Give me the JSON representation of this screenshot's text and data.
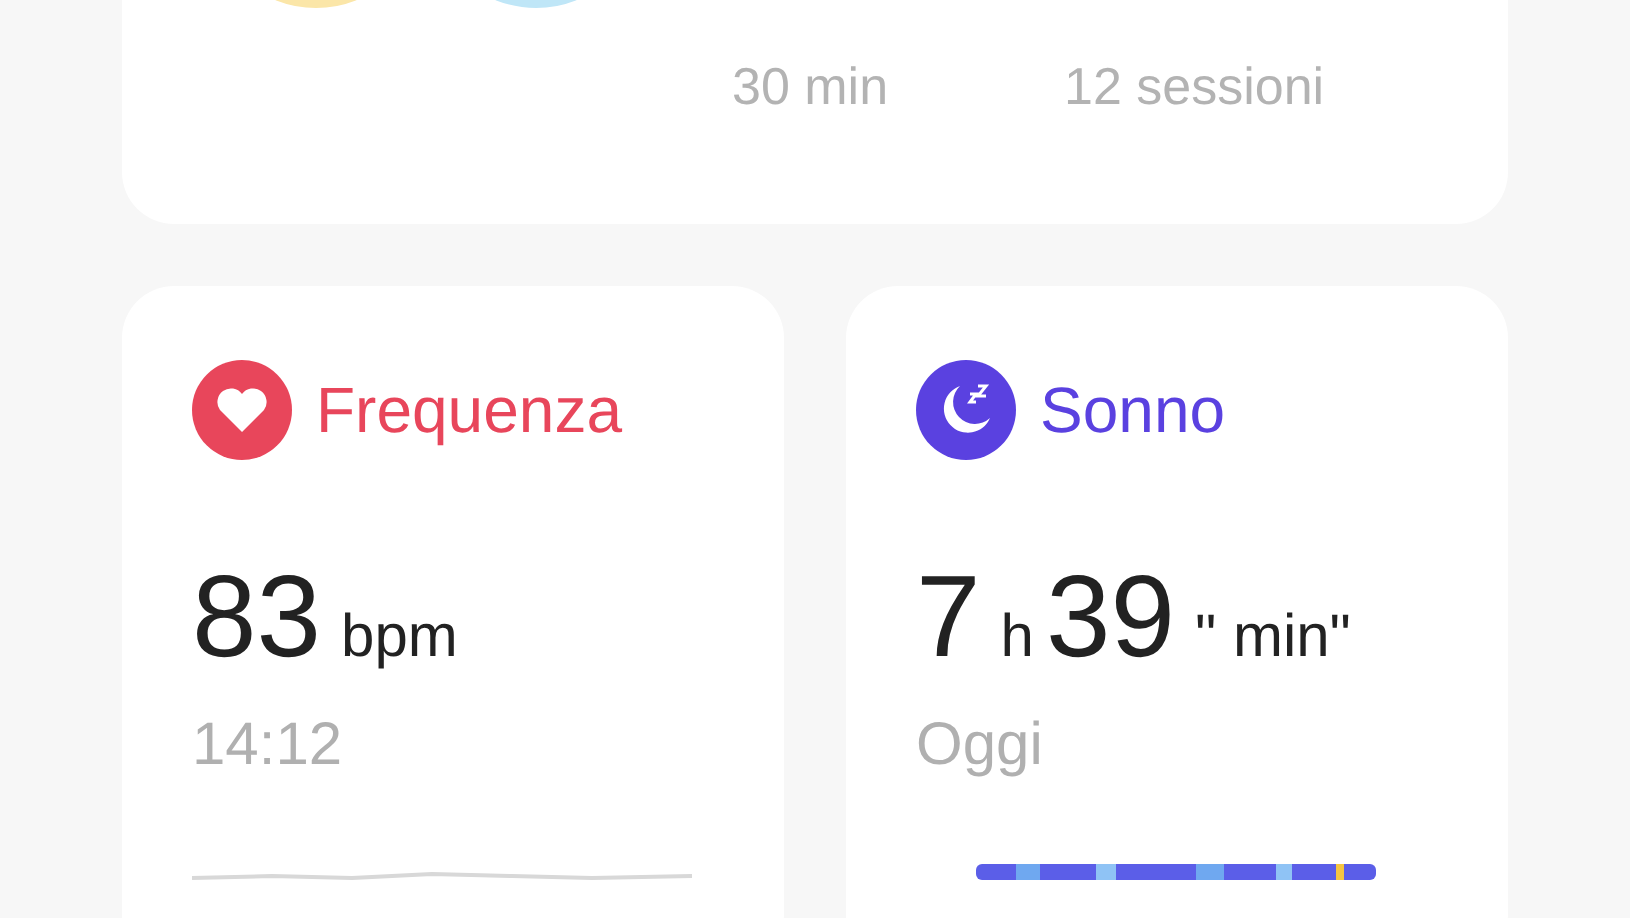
{
  "summary": {
    "stats": [
      {
        "note": "30 min"
      },
      {
        "note": "12 sessioni"
      }
    ]
  },
  "cards": [
    {
      "kind": "heart",
      "title": "Frequenza",
      "color": "#e8465b",
      "value": [
        {
          "kind": "number",
          "text": "83"
        },
        {
          "kind": "unit",
          "text": "bpm"
        }
      ],
      "note": "14:12"
    },
    {
      "kind": "sleep",
      "title": "Sonno",
      "color": "#5a41e0",
      "value": [
        {
          "kind": "number",
          "text": "7"
        },
        {
          "kind": "unit",
          "text": "h"
        },
        {
          "kind": "number",
          "text": "39"
        },
        {
          "kind": "unit",
          "text": "\" min\""
        }
      ],
      "note": "Oggi"
    }
  ]
}
